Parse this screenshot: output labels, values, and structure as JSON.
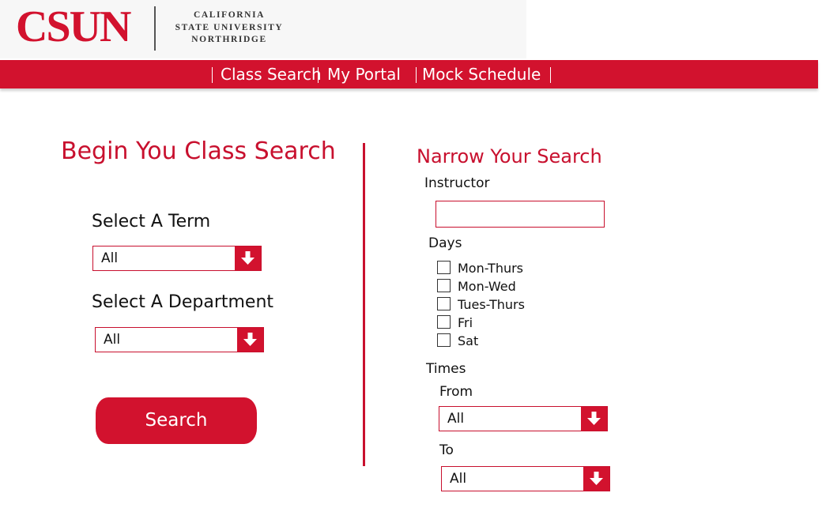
{
  "brand": {
    "logo_text": "CSUN",
    "name_lines": [
      "CALIFORNIA",
      "STATE UNIVERSITY",
      "NORTHRIDGE"
    ],
    "brand_color": "#d2122e"
  },
  "nav": {
    "items": [
      {
        "label": "Class Search"
      },
      {
        "label": "My Portal"
      },
      {
        "label": "Mock Schedule"
      }
    ]
  },
  "left": {
    "heading": "Begin You Class Search",
    "term_label": "Select A Term",
    "term_value": "All",
    "department_label": "Select A Department",
    "department_value": "All",
    "search_label": "Search"
  },
  "right": {
    "heading": "Narrow Your Search",
    "instructor_label": "Instructor",
    "instructor_value": "",
    "days_label": "Days",
    "days": [
      {
        "label": "Mon-Thurs",
        "checked": false
      },
      {
        "label": "Mon-Wed",
        "checked": false
      },
      {
        "label": "Tues-Thurs",
        "checked": false
      },
      {
        "label": "Fri",
        "checked": false
      },
      {
        "label": "Sat",
        "checked": false
      }
    ],
    "times_label": "Times",
    "from_label": "From",
    "from_value": "All",
    "to_label": "To",
    "to_value": "All"
  },
  "icons": {
    "dropdown": "arrow-down-icon",
    "checkbox": "checkbox-icon"
  }
}
